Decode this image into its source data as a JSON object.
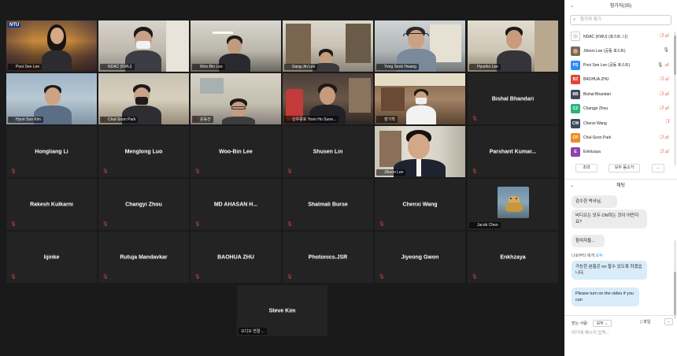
{
  "gallery": {
    "video_tiles": [
      {
        "id": "t1",
        "label": "Pooi See Lee",
        "muted": false
      },
      {
        "id": "t2",
        "label": "NDAC (KWU)",
        "muted": false
      },
      {
        "id": "t3",
        "label": "Woo-Bin Lee",
        "muted": false
      },
      {
        "id": "t4",
        "label": "Sang-Jin Lee",
        "muted": false
      },
      {
        "id": "t5",
        "label": "Yong Seok Hwang",
        "muted": false
      },
      {
        "id": "t6",
        "label": "Hyunho Lee",
        "muted": false
      },
      {
        "id": "t7",
        "label": "Hyun Soo Kim",
        "muted": true
      },
      {
        "id": "t8",
        "label": "Chul-Soon Park",
        "muted": true
      },
      {
        "id": "t9",
        "label": "윤동진",
        "muted": true
      },
      {
        "id": "t10",
        "label": "신우중호 Yoon Ho Sune...",
        "muted": true
      },
      {
        "id": "t11",
        "label": "장기혁",
        "muted": true
      },
      {
        "id": "t12",
        "label": "Jihoon Lee",
        "muted": false
      },
      {
        "id": "t13",
        "label": "Jacob Chen",
        "muted": true
      },
      {
        "id": "t14",
        "label": "오디오 연결 ...",
        "muted": false
      }
    ],
    "name_tiles": [
      {
        "name": "Bishal Bhandari"
      },
      {
        "name": "Hongliang Li"
      },
      {
        "name": "Menglong Luo"
      },
      {
        "name": "Woo-Bin Lee"
      },
      {
        "name": "Shusen Lin"
      },
      {
        "name": "Parshant  Kumar..."
      },
      {
        "name": "Rakesh Kulkarni"
      },
      {
        "name": "Changyi Zhou"
      },
      {
        "name": "MD  AHASAN  H..."
      },
      {
        "name": "Shalmali Burse"
      },
      {
        "name": "Chenxi Wang"
      },
      {
        "name": "lijinke"
      },
      {
        "name": "Rutuja Mandavkar"
      },
      {
        "name": "BAOHUA ZHU"
      },
      {
        "name": "Photonics.JSR"
      },
      {
        "name": "Jiyeong Gwon"
      },
      {
        "name": "Enkhzaya"
      },
      {
        "name": "Steve Kim"
      }
    ],
    "ntu_logo": "NTU",
    "active_speaker_color": "#c8e05a",
    "muted_icon_color": "#e0463a"
  },
  "participants_panel": {
    "title": "참가자(35)",
    "search_placeholder": "참가자 찾기",
    "participants": [
      {
        "avatar_text": "",
        "avatar_color": "#ffffff",
        "name": "NDAC (KWU) (호스트, 나)",
        "mic": "muted",
        "cam": "off"
      },
      {
        "avatar_text": "",
        "avatar_color": "#7a6a5a",
        "name": "Jihoon Lee (공동 호스트)",
        "mic": "on",
        "cam": "on"
      },
      {
        "avatar_text": "PS",
        "avatar_color": "#2d8cff",
        "name": "Pooi See Lee (공동 호스트)",
        "mic": "on",
        "cam": "off"
      },
      {
        "avatar_text": "BZ",
        "avatar_color": "#e0463a",
        "name": "BAOHUA ZHU",
        "mic": "muted",
        "cam": "off"
      },
      {
        "avatar_text": "BB",
        "avatar_color": "#3d4a5c",
        "name": "Bishal Bhandari",
        "mic": "muted",
        "cam": "off"
      },
      {
        "avatar_text": "CZ",
        "avatar_color": "#28b47e",
        "name": "Changyi Zhou",
        "mic": "muted",
        "cam": "off"
      },
      {
        "avatar_text": "CW",
        "avatar_color": "#3d4a5c",
        "name": "Chenxi Wang",
        "mic": "muted",
        "cam": ""
      },
      {
        "avatar_text": "CP",
        "avatar_color": "#f08a24",
        "name": "Chul-Soon Park",
        "mic": "muted",
        "cam": "off"
      },
      {
        "avatar_text": "E",
        "avatar_color": "#8e44ad",
        "name": "Enkhzaya",
        "mic": "muted",
        "cam": "off"
      }
    ],
    "invite_label": "초대",
    "mute_all_label": "모두 음소거",
    "more_label": "..."
  },
  "chat_panel": {
    "title": "채팅",
    "messages": [
      {
        "text": "감수한 박사님,",
        "mine": false
      },
      {
        "text": "비디오는 모두 ON하는 것이 어떤지요?",
        "mine": false
      },
      {
        "text": "참여자들...",
        "mine": false
      },
      {
        "text": "가능한 분들은 on 할수 있도록 하겠습니다.",
        "mine": true
      },
      {
        "text": "Please turn on the video if you can",
        "mine": true
      }
    ],
    "sender_prefix": "나로부터 에게",
    "sender_to": "모두:",
    "to_label": "받는 사람:",
    "to_value": "모두",
    "file_label": "파일",
    "more_label": "...",
    "input_placeholder": "여기에 메시지 입력..."
  }
}
